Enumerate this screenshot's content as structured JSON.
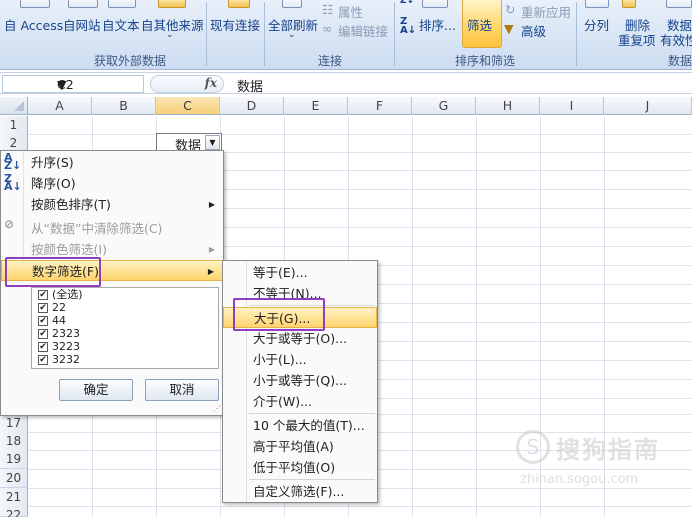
{
  "ribbon": {
    "buttons": {
      "from_access": "自 Access",
      "from_web": "自网站",
      "from_text": "自文本",
      "from_other": "自其他来源",
      "existing_conn": "现有连接",
      "refresh_all": "全部刷新",
      "properties": "属性",
      "edit_links": "编辑链接",
      "sort": "排序...",
      "filter": "筛选",
      "reapply": "重新应用",
      "advanced": "高级",
      "split": "分列",
      "remove_dup_1": "删除",
      "remove_dup_2": "重复项",
      "data_valid_1": "数据",
      "data_valid_2": "有效性"
    },
    "groups": {
      "get_external": "获取外部数据",
      "connections": "连接",
      "sort_filter": "排序和筛选",
      "data_tools": "数据"
    }
  },
  "formula_bar": {
    "name_box": "C2",
    "fx": "fx",
    "content": "数据"
  },
  "grid": {
    "columns": [
      "A",
      "B",
      "C",
      "D",
      "E",
      "F",
      "G",
      "H",
      "I",
      "J"
    ],
    "rows": [
      "1",
      "2",
      "17",
      "18",
      "19",
      "20",
      "21",
      "22"
    ],
    "c2_value": "数据"
  },
  "filter_menu": {
    "sort_asc": "升序(S)",
    "sort_desc": "降序(O)",
    "sort_by_color": "按颜色排序(T)",
    "clear_filter": "从“数据”中清除筛选(C)",
    "filter_by_color": "按颜色筛选(I)",
    "number_filter": "数字筛选(F)",
    "values": [
      "(全选)",
      "22",
      "44",
      "2323",
      "3223",
      "3232"
    ],
    "ok": "确定",
    "cancel": "取消"
  },
  "number_filter_submenu": {
    "items": [
      "等于(E)...",
      "不等于(N)...",
      "大于(G)...",
      "大于或等于(O)...",
      "小于(L)...",
      "小于或等于(Q)...",
      "介于(W)...",
      "10 个最大的值(T)...",
      "高于平均值(A)",
      "低于平均值(O)",
      "自定义筛选(F)..."
    ]
  },
  "watermark": {
    "title": "搜狗指南",
    "url": "zhinan.sogou.com"
  }
}
